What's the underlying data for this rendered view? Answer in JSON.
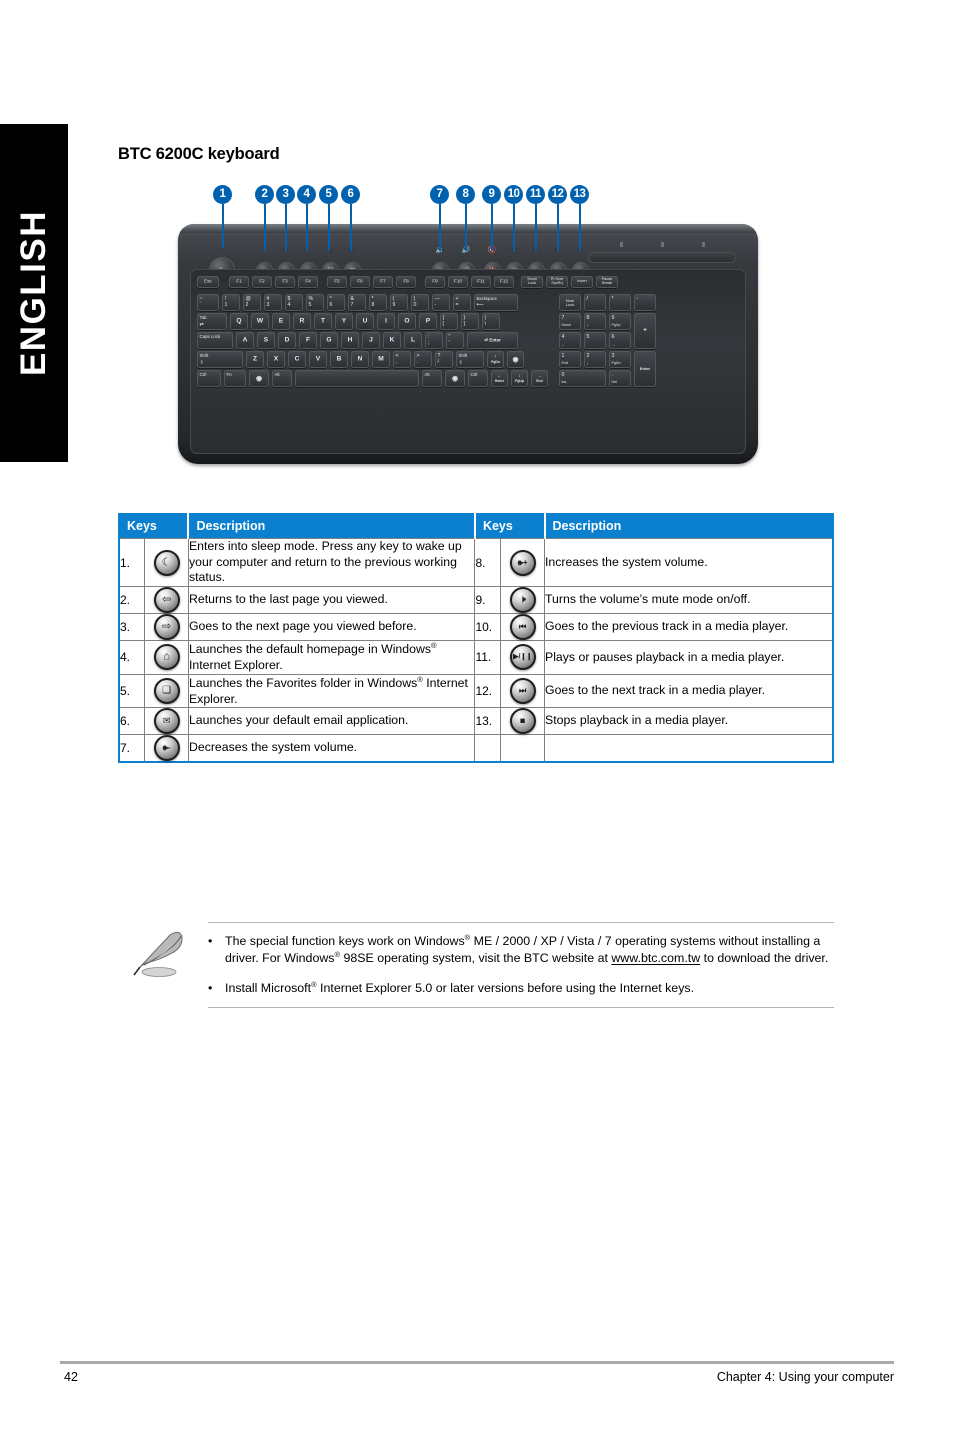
{
  "language_tab": "ENGLISH",
  "page_title": "BTC 6200C keyboard",
  "figure": {
    "callouts": [
      "1",
      "2",
      "3",
      "4",
      "5",
      "6",
      "7",
      "8",
      "9",
      "10",
      "11",
      "12",
      "13"
    ],
    "keyboard_alt": "BTC 6200C multimedia keyboard top view",
    "function_rows": {
      "row_fn": [
        "Esc",
        "F1",
        "F2",
        "F3",
        "F4",
        "F5",
        "F6",
        "F7",
        "F8",
        "F9",
        "F10",
        "F11",
        "F12",
        "Scroll Lock",
        "Pt Scrn SysRq",
        "Insert",
        "Pause Break"
      ],
      "row_num_top": [
        "~",
        "!",
        "@",
        "#",
        "$",
        "%",
        "^",
        "&",
        "*",
        "(",
        ")",
        "—",
        "+"
      ],
      "row_num_bot": [
        "`",
        "1",
        "2",
        "3",
        "4",
        "5",
        "6",
        "7",
        "8",
        "9",
        "0",
        "-",
        "="
      ],
      "row_q": [
        "Q",
        "W",
        "E",
        "R",
        "T",
        "Y",
        "U",
        "I",
        "O",
        "P",
        "[",
        "]",
        "\\"
      ],
      "row_a": [
        "A",
        "S",
        "D",
        "F",
        "G",
        "H",
        "J",
        "K",
        "L",
        ";",
        "'"
      ],
      "row_z": [
        "Z",
        "X",
        "C",
        "V",
        "B",
        "N",
        "M",
        "<",
        ">",
        "?"
      ],
      "row_z_bot": [
        ",",
        ".",
        "/"
      ],
      "tab_label": "Tab",
      "caps_label": "Caps Lock",
      "enter_label": "Enter",
      "backspace_label": "Backspace",
      "shift_label": "Shift",
      "ctrl_label": "Ctrl",
      "alt_label": "Alt"
    },
    "numpad": {
      "row1": [
        "Num Lock",
        "/",
        "*",
        "-"
      ],
      "row2": [
        "7 Home",
        "8",
        "9 PgUp"
      ],
      "row3": [
        "4",
        "5",
        "6"
      ],
      "row4": [
        "1 End",
        "2",
        "3 PgDn"
      ],
      "row5": [
        "0 Ins",
        ". Del"
      ],
      "plus": "+",
      "enter": "Enter"
    }
  },
  "table": {
    "headers": [
      "Keys",
      "Description",
      "Keys",
      "Description"
    ],
    "rows": [
      {
        "left_num": "1.",
        "left_icon": "sleep-moon-icon",
        "left_desc": "Enters into sleep mode. Press any key to wake up your computer and return to the previous working status.",
        "right_num": "8.",
        "right_icon": "volume-up-icon",
        "right_desc": "Increases the system volume."
      },
      {
        "left_num": "2.",
        "left_icon": "back-arrow-icon",
        "left_desc": "Returns to the last page you viewed.",
        "right_num": "9.",
        "right_icon": "volume-mute-icon",
        "right_desc": "Turns the volume’s mute mode on/off."
      },
      {
        "left_num": "3.",
        "left_icon": "forward-arrow-icon",
        "left_desc": "Goes to the next page you viewed before.",
        "right_num": "10.",
        "right_icon": "previous-track-icon",
        "right_desc": "Goes to the previous track in a media player."
      },
      {
        "left_num": "4.",
        "left_icon": "home-house-icon",
        "left_desc_pre": "Launches the default homepage in Windows",
        "left_desc_post": " Internet Explorer.",
        "left_desc": "Launches the default homepage in Windows® Internet Explorer.",
        "right_num": "11.",
        "right_icon": "play-pause-icon",
        "right_desc": "Plays or pauses playback in a media player."
      },
      {
        "left_num": "5.",
        "left_icon": "favorites-folder-icon",
        "left_desc_pre": "Launches the Favorites folder in Windows",
        "left_desc_post": " Internet Explorer.",
        "left_desc": "Launches the Favorites folder in Windows® Internet Explorer.",
        "right_num": "12.",
        "right_icon": "next-track-icon",
        "right_desc": "Goes to the next track in a media player."
      },
      {
        "left_num": "6.",
        "left_icon": "email-envelope-icon",
        "left_desc": "Launches your default email application.",
        "right_num": "13.",
        "right_icon": "stop-icon",
        "right_desc": "Stops playback in a media player."
      },
      {
        "left_num": "7.",
        "left_icon": "volume-down-icon",
        "left_desc": "Decreases the system volume.",
        "right_num": "",
        "right_icon": "",
        "right_desc": ""
      }
    ]
  },
  "note": {
    "icon": "note-feather-icon",
    "bullet": "•",
    "items": [
      {
        "seg1": "The special function keys work on Windows",
        "sup1": "®",
        "seg2": " ME / 2000 / XP / Vista / 7 operating systems without installing a driver. For Windows",
        "sup2": "®",
        "seg3": " 98SE operating system, visit the BTC website at ",
        "link": "www.btc.com.tw",
        "seg4": " to download the driver."
      },
      {
        "seg1": "Install Microsoft",
        "sup1": "®",
        "seg2": " Internet Explorer 5.0 or later versions before using the Internet keys."
      }
    ]
  },
  "footer": {
    "page_number": "42",
    "chapter": "Chapter 4: Using your computer"
  },
  "colors": {
    "accent_blue": "#0b80cf",
    "callout_blue": "#0062ae",
    "tab_black": "#000000"
  }
}
